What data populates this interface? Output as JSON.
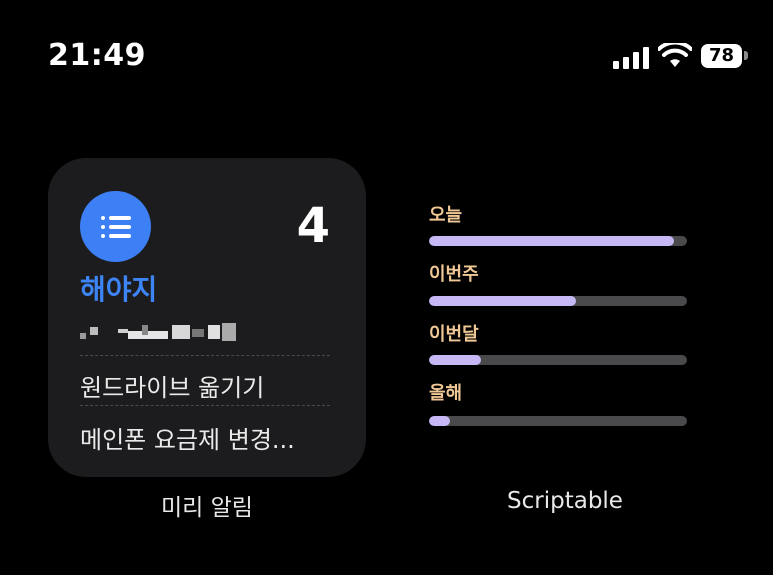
{
  "status_bar": {
    "time": "21:49",
    "battery": "78"
  },
  "reminders_widget": {
    "count": "4",
    "list_title": "해야지",
    "items": [
      "원드라이브 옮기기",
      "메인폰 요금제 변경..."
    ],
    "caption": "미리 알림",
    "accent_color": "#3d85f7"
  },
  "scriptable_widget": {
    "caption": "Scriptable",
    "bar_color": "#c6b8f4",
    "stats": [
      {
        "label": "오늘",
        "progress": 0.95
      },
      {
        "label": "이번주",
        "progress": 0.57
      },
      {
        "label": "이번달",
        "progress": 0.2
      },
      {
        "label": "올해",
        "progress": 0.08
      }
    ]
  }
}
